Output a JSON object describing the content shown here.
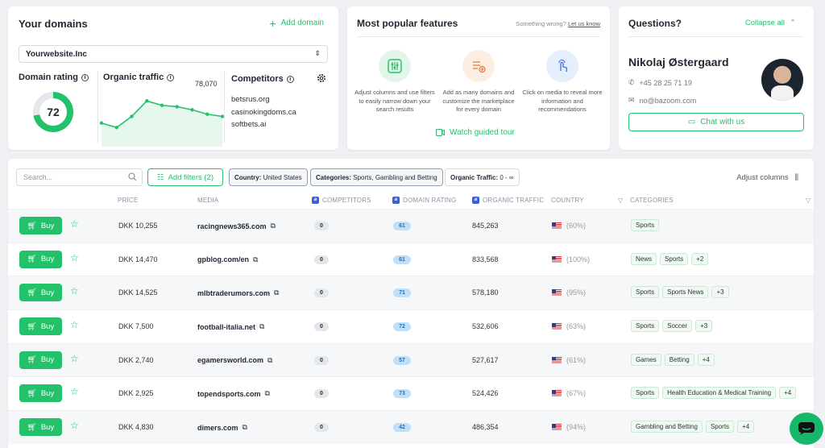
{
  "domains_card": {
    "title": "Your domains",
    "add_domain": "Add domain",
    "selected_domain": "Yourwebsite.Inc",
    "domain_rating_label": "Domain rating",
    "domain_rating_value": "72",
    "organic_traffic_label": "Organic traffic",
    "organic_traffic_value": "78,070",
    "traffic_trend": [
      0.35,
      0.25,
      0.5,
      0.85,
      0.75,
      0.72,
      0.65,
      0.55,
      0.5
    ],
    "competitors_label": "Competitors",
    "competitors": [
      "betsrus.org",
      "casinokingdoms.ca",
      "softbets.ai"
    ]
  },
  "features_card": {
    "title": "Most popular features",
    "something_wrong": "Something wrong?",
    "let_us_know": "Let us know",
    "features": [
      {
        "text": "Adjust columns and use filters to easily narrow down your search results",
        "icon": "sliders-icon"
      },
      {
        "text": "Add as many domains and customize the marketplace for every domain",
        "icon": "list-add-icon"
      },
      {
        "text": "Click on media to reveal more information and recommendations",
        "icon": "tap-icon"
      }
    ],
    "guided_tour": "Watch guided tour"
  },
  "questions_card": {
    "title": "Questions?",
    "collapse_all": "Collapse all",
    "name": "Nikolaj Østergaard",
    "phone": "+45 28 25 71 19",
    "email": "no@bazoom.com",
    "chat": "Chat with us"
  },
  "toolbar": {
    "search_placeholder": "Search...",
    "add_filters": "Add filters (2)",
    "country_key": "Country:",
    "country_val": "United States",
    "categories_key": "Categories:",
    "categories_val": "Sports, Gambling and Betting",
    "traffic_key": "Organic Traffic:",
    "traffic_val": "0 - ∞",
    "adjust_columns": "Adjust columns"
  },
  "columns": {
    "price": "PRICE",
    "media": "MEDIA",
    "competitors": "COMPETITORS",
    "domain_rating": "DOMAIN RATING",
    "organic_traffic": "ORGANIC TRAFFIC",
    "country": "COUNTRY",
    "categories": "CATEGORIES"
  },
  "buy_label": "Buy",
  "rows": [
    {
      "price": "DKK 10,255",
      "media": "racingnews365.com",
      "competitors": "0",
      "dr": "61",
      "traffic": "845,263",
      "country_pct": "(60%)",
      "tags": [
        "Sports"
      ]
    },
    {
      "price": "DKK 14,470",
      "media": "gpblog.com/en",
      "competitors": "0",
      "dr": "61",
      "traffic": "833,568",
      "country_pct": "(100%)",
      "tags": [
        "News",
        "Sports",
        "+2"
      ]
    },
    {
      "price": "DKK 14,525",
      "media": "mlbtraderumors.com",
      "competitors": "0",
      "dr": "71",
      "traffic": "578,180",
      "country_pct": "(95%)",
      "tags": [
        "Sports",
        "Sports News",
        "+3"
      ]
    },
    {
      "price": "DKK 7,500",
      "media": "football-italia.net",
      "competitors": "0",
      "dr": "72",
      "traffic": "532,606",
      "country_pct": "(63%)",
      "tags": [
        "Sports",
        "Soccer",
        "+3"
      ]
    },
    {
      "price": "DKK 2,740",
      "media": "egamersworld.com",
      "competitors": "0",
      "dr": "57",
      "traffic": "527,617",
      "country_pct": "(61%)",
      "tags": [
        "Games",
        "Betting",
        "+4"
      ]
    },
    {
      "price": "DKK 2,925",
      "media": "topendsports.com",
      "competitors": "0",
      "dr": "73",
      "traffic": "524,426",
      "country_pct": "(67%)",
      "tags": [
        "Sports",
        "Health Education & Medical Training",
        "+4"
      ]
    },
    {
      "price": "DKK 4,830",
      "media": "dimers.com",
      "competitors": "0",
      "dr": "42",
      "traffic": "486,354",
      "country_pct": "(94%)",
      "tags": [
        "Gambling and Betting",
        "Sports",
        "+4"
      ]
    }
  ],
  "colors": {
    "accent": "#24c16b",
    "dr_badge": "#bfe0fb",
    "brand_square": "#3d5fd8"
  }
}
